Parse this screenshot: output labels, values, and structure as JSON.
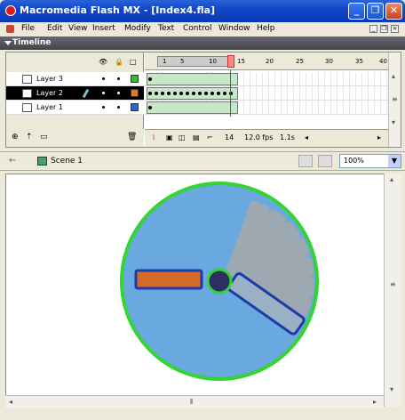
{
  "window": {
    "title": "Macromedia Flash MX - [Index4.fla]",
    "buttons": {
      "minimize": "_",
      "restore": "❐",
      "close": "✕"
    }
  },
  "menu": {
    "items": [
      "File",
      "Edit",
      "View",
      "Insert",
      "Modify",
      "Text",
      "Control",
      "Window",
      "Help"
    ],
    "mdi_buttons": [
      "_",
      "❐",
      "×"
    ]
  },
  "timeline": {
    "title": "Timeline",
    "column_icons": {
      "eye": "👁",
      "lock": "🔒",
      "outline": "□"
    },
    "ruler_labels": [
      "1",
      "5",
      "10",
      "15",
      "20",
      "25",
      "30",
      "35",
      "40"
    ],
    "layers": [
      {
        "name": "Layer 3",
        "color": "#2fbf2f",
        "selected": false,
        "keyframes": 1
      },
      {
        "name": "Layer 2",
        "color": "#e07a2a",
        "selected": true,
        "keyframes": 14
      },
      {
        "name": "Layer 1",
        "color": "#2a63d8",
        "selected": false,
        "keyframes": 1
      }
    ],
    "footer": {
      "current_frame": "14",
      "frame_rate": "12.0 fps",
      "elapsed": "1.1s"
    }
  },
  "scene": {
    "label": "Scene 1",
    "zoom": "100%"
  },
  "stage": {
    "colors": {
      "circle_fill": "#6aa8e0",
      "circle_stroke": "#33d433",
      "bar_fill": "#d36a2a",
      "bar_stroke": "#1c3da8",
      "knob_fill": "#2b2f63",
      "knob_stroke": "#33d433",
      "rotated_bar_fill": "#9ab0c4",
      "ghost_fill": "#c9a98a"
    }
  }
}
